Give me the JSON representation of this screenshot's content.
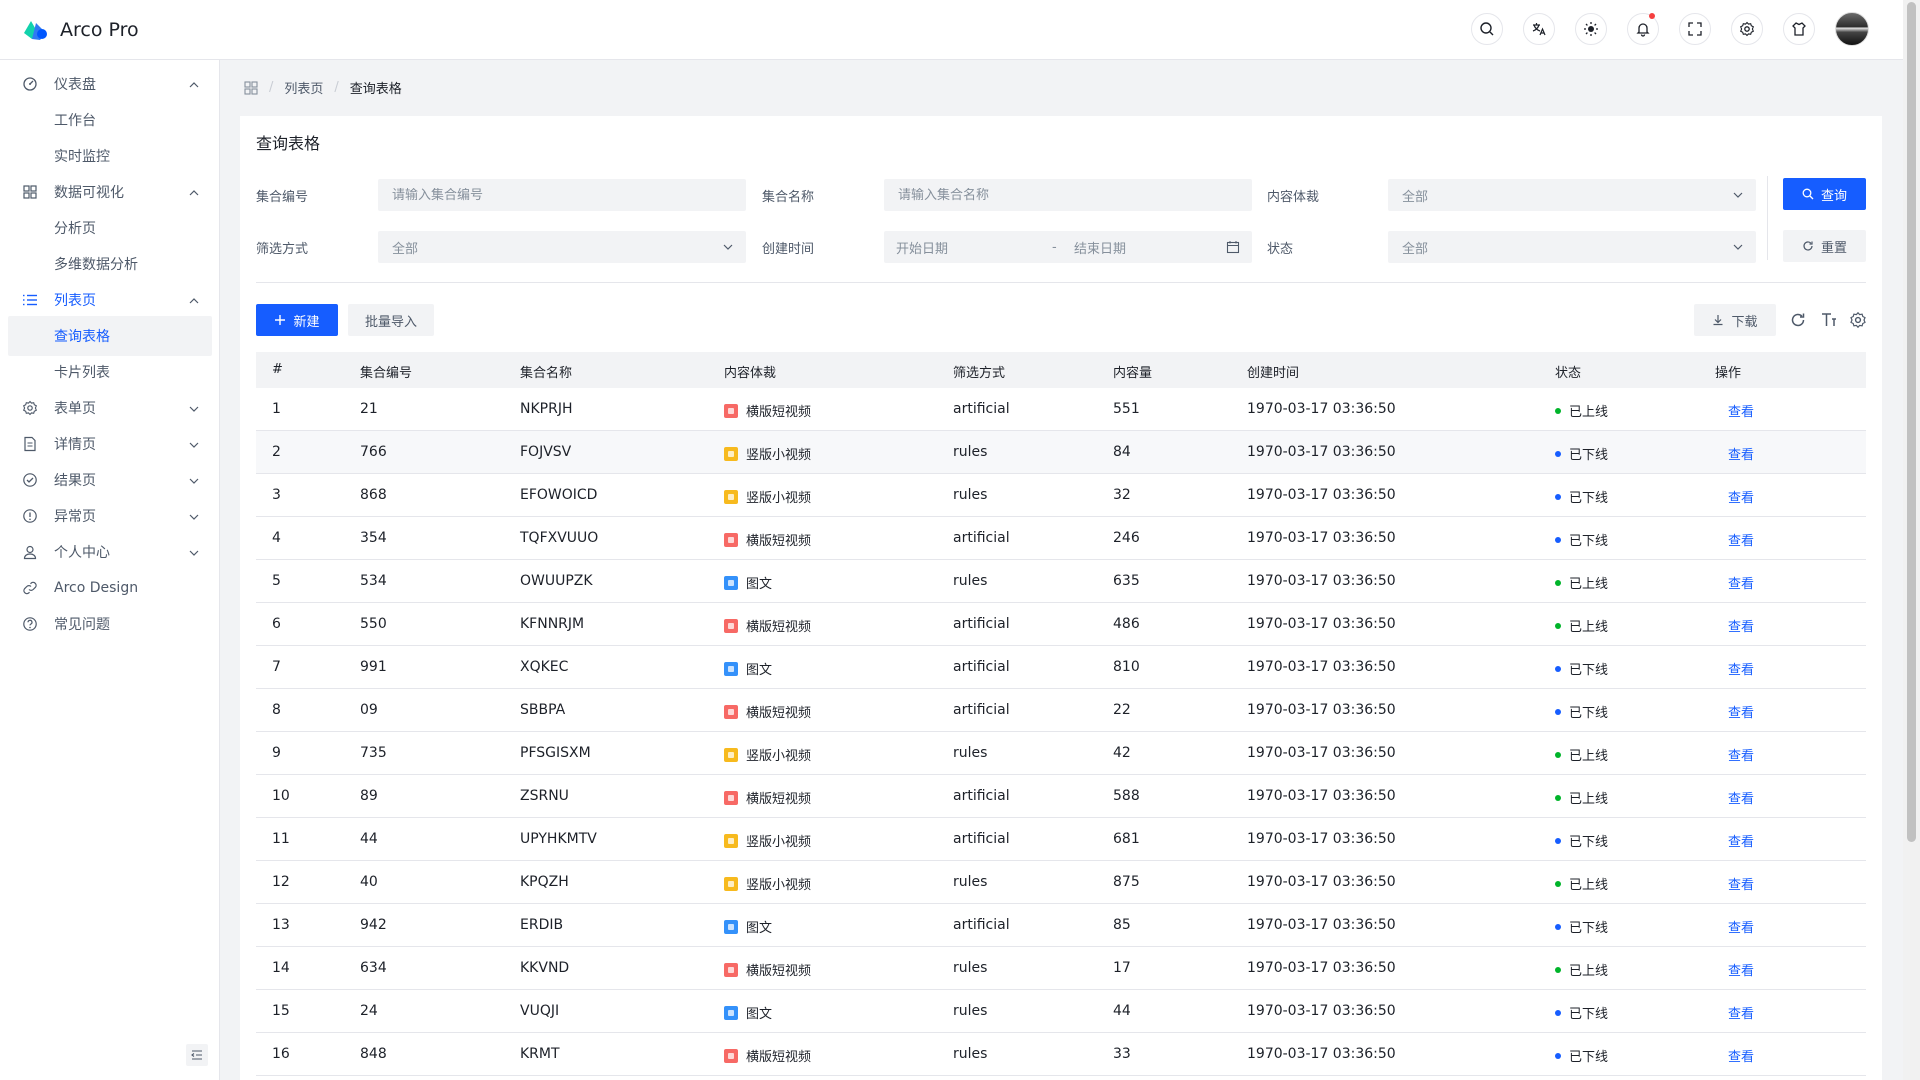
{
  "app": {
    "name": "Arco Pro"
  },
  "sidebar": {
    "items": [
      {
        "label": "仪表盘",
        "icon": "dashboard-icon",
        "arrow": "up"
      },
      {
        "label": "工作台",
        "sub": true
      },
      {
        "label": "实时监控",
        "sub": true
      },
      {
        "label": "数据可视化",
        "icon": "apps-icon",
        "arrow": "up"
      },
      {
        "label": "分析页",
        "sub": true
      },
      {
        "label": "多维数据分析",
        "sub": true
      },
      {
        "label": "列表页",
        "icon": "list-icon",
        "arrow": "up",
        "group_active": true
      },
      {
        "label": "查询表格",
        "sub": true,
        "active": true
      },
      {
        "label": "卡片列表",
        "sub": true
      },
      {
        "label": "表单页",
        "icon": "settings-icon",
        "arrow": "down"
      },
      {
        "label": "详情页",
        "icon": "file-icon",
        "arrow": "down"
      },
      {
        "label": "结果页",
        "icon": "check-circle-icon",
        "arrow": "down"
      },
      {
        "label": "异常页",
        "icon": "exclamation-circle-icon",
        "arrow": "down"
      },
      {
        "label": "个人中心",
        "icon": "user-icon",
        "arrow": "down"
      },
      {
        "label": "Arco Design",
        "icon": "link-icon"
      },
      {
        "label": "常见问题",
        "icon": "question-circle-icon"
      }
    ]
  },
  "breadcrumb": {
    "items": [
      "列表页",
      "查询表格"
    ]
  },
  "card": {
    "title": "查询表格"
  },
  "form": {
    "id_label": "集合编号",
    "id_placeholder": "请输入集合编号",
    "name_label": "集合名称",
    "name_placeholder": "请输入集合名称",
    "content_label": "内容体裁",
    "content_value": "全部",
    "filter_label": "筛选方式",
    "filter_value": "全部",
    "created_label": "创建时间",
    "start_placeholder": "开始日期",
    "end_placeholder": "结束日期",
    "range_sep": "-",
    "status_label": "状态",
    "status_value": "全部",
    "search_button": "查询",
    "reset_button": "重置"
  },
  "toolbar": {
    "new_button": "新建",
    "import_button": "批量导入",
    "download_button": "下载"
  },
  "table": {
    "headers": [
      "#",
      "集合编号",
      "集合名称",
      "内容体裁",
      "筛选方式",
      "内容量",
      "创建时间",
      "状态",
      "操作"
    ],
    "rows": [
      {
        "n": "1",
        "id": "21",
        "name": "NKPRJH",
        "type": "横版短视频",
        "tag": "pink",
        "filter": "artificial",
        "count": "551",
        "time": "1970-03-17 03:36:50",
        "status": "已上线",
        "online": true,
        "action": "查看"
      },
      {
        "n": "2",
        "id": "766",
        "name": "FOJVSV",
        "type": "竖版小视频",
        "tag": "orange",
        "filter": "rules",
        "count": "84",
        "time": "1970-03-17 03:36:50",
        "status": "已下线",
        "online": false,
        "action": "查看"
      },
      {
        "n": "3",
        "id": "868",
        "name": "EFOWOICD",
        "type": "竖版小视频",
        "tag": "orange",
        "filter": "rules",
        "count": "32",
        "time": "1970-03-17 03:36:50",
        "status": "已下线",
        "online": false,
        "action": "查看"
      },
      {
        "n": "4",
        "id": "354",
        "name": "TQFXVUUO",
        "type": "横版短视频",
        "tag": "pink",
        "filter": "artificial",
        "count": "246",
        "time": "1970-03-17 03:36:50",
        "status": "已下线",
        "online": false,
        "action": "查看"
      },
      {
        "n": "5",
        "id": "534",
        "name": "OWUUPZK",
        "type": "图文",
        "tag": "blue",
        "filter": "rules",
        "count": "635",
        "time": "1970-03-17 03:36:50",
        "status": "已上线",
        "online": true,
        "action": "查看"
      },
      {
        "n": "6",
        "id": "550",
        "name": "KFNNRJM",
        "type": "横版短视频",
        "tag": "pink",
        "filter": "artificial",
        "count": "486",
        "time": "1970-03-17 03:36:50",
        "status": "已上线",
        "online": true,
        "action": "查看"
      },
      {
        "n": "7",
        "id": "991",
        "name": "XQKEC",
        "type": "图文",
        "tag": "blue",
        "filter": "artificial",
        "count": "810",
        "time": "1970-03-17 03:36:50",
        "status": "已下线",
        "online": false,
        "action": "查看"
      },
      {
        "n": "8",
        "id": "09",
        "name": "SBBPA",
        "type": "横版短视频",
        "tag": "pink",
        "filter": "artificial",
        "count": "22",
        "time": "1970-03-17 03:36:50",
        "status": "已下线",
        "online": false,
        "action": "查看"
      },
      {
        "n": "9",
        "id": "735",
        "name": "PFSGISXM",
        "type": "竖版小视频",
        "tag": "orange",
        "filter": "rules",
        "count": "42",
        "time": "1970-03-17 03:36:50",
        "status": "已上线",
        "online": true,
        "action": "查看"
      },
      {
        "n": "10",
        "id": "89",
        "name": "ZSRNU",
        "type": "横版短视频",
        "tag": "pink",
        "filter": "artificial",
        "count": "588",
        "time": "1970-03-17 03:36:50",
        "status": "已上线",
        "online": true,
        "action": "查看"
      },
      {
        "n": "11",
        "id": "44",
        "name": "UPYHKMTV",
        "type": "竖版小视频",
        "tag": "orange",
        "filter": "artificial",
        "count": "681",
        "time": "1970-03-17 03:36:50",
        "status": "已下线",
        "online": false,
        "action": "查看"
      },
      {
        "n": "12",
        "id": "40",
        "name": "KPQZH",
        "type": "竖版小视频",
        "tag": "orange",
        "filter": "rules",
        "count": "875",
        "time": "1970-03-17 03:36:50",
        "status": "已上线",
        "online": true,
        "action": "查看"
      },
      {
        "n": "13",
        "id": "942",
        "name": "ERDIB",
        "type": "图文",
        "tag": "blue",
        "filter": "artificial",
        "count": "85",
        "time": "1970-03-17 03:36:50",
        "status": "已下线",
        "online": false,
        "action": "查看"
      },
      {
        "n": "14",
        "id": "634",
        "name": "KKVND",
        "type": "横版短视频",
        "tag": "pink",
        "filter": "rules",
        "count": "17",
        "time": "1970-03-17 03:36:50",
        "status": "已上线",
        "online": true,
        "action": "查看"
      },
      {
        "n": "15",
        "id": "24",
        "name": "VUQJI",
        "type": "图文",
        "tag": "blue",
        "filter": "rules",
        "count": "44",
        "time": "1970-03-17 03:36:50",
        "status": "已下线",
        "online": false,
        "action": "查看"
      },
      {
        "n": "16",
        "id": "848",
        "name": "KRMT",
        "type": "横版短视频",
        "tag": "pink",
        "filter": "rules",
        "count": "33",
        "time": "1970-03-17 03:36:50",
        "status": "已下线",
        "online": false,
        "action": "查看"
      }
    ]
  },
  "colors": {
    "primary": "#165dff",
    "online": "#00b42a",
    "offline": "#165dff",
    "notification_dot": "#f53f3f"
  }
}
